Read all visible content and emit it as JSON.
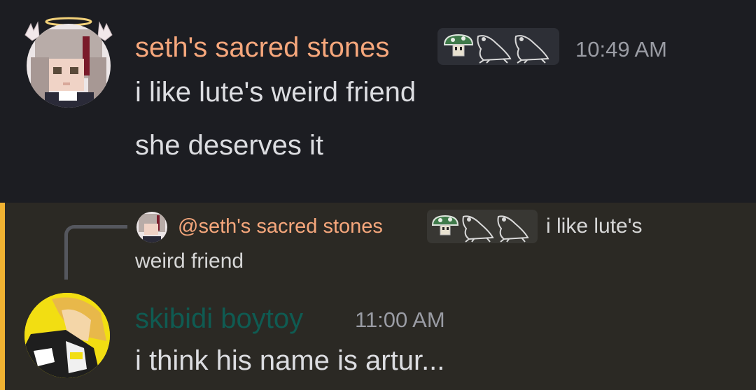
{
  "messages": [
    {
      "author": "seth's sacred stones",
      "author_color": "#f6a77c",
      "badges": [
        "mushroom-icon",
        "frog-icon",
        "frog-icon"
      ],
      "time": "10:49 AM",
      "lines": [
        "i like lute's weird friend",
        "she deserves it"
      ]
    },
    {
      "reply": {
        "author": "@seth's sacred stones",
        "author_color": "#f6a77c",
        "badges": [
          "mushroom-icon",
          "frog-icon",
          "frog-icon"
        ],
        "preview_line1": "i like lute's",
        "preview_line2": "weird friend"
      },
      "author": "skibidi boytoy",
      "author_color": "#0f5b52",
      "time": "11:00 AM",
      "lines": [
        "i think his name is artur..."
      ],
      "highlight_color": "#f0b232"
    }
  ]
}
